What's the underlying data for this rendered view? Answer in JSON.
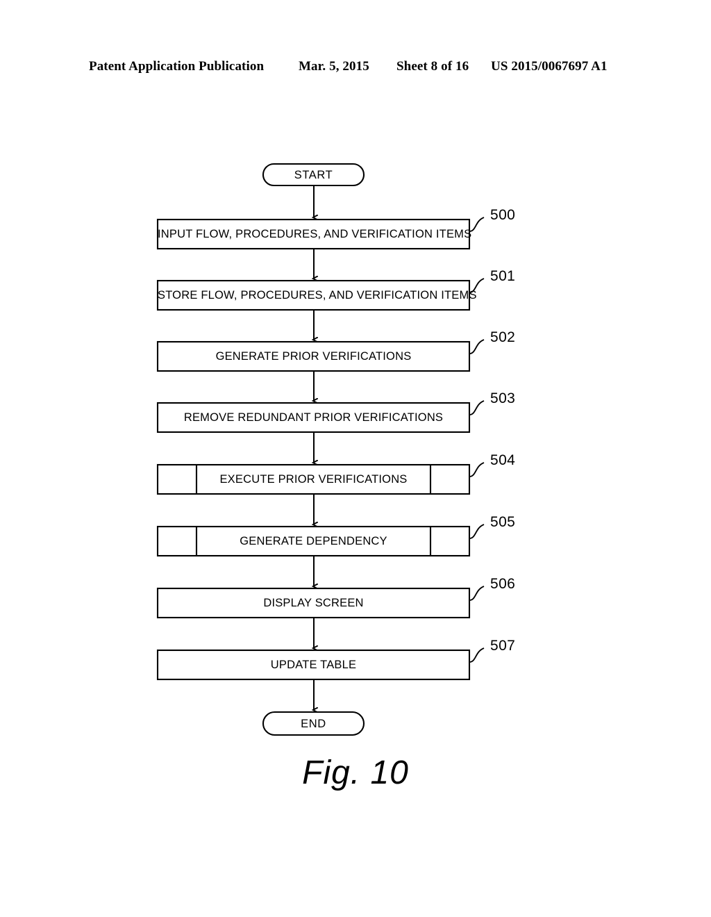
{
  "header": {
    "publication": "Patent Application Publication",
    "date": "Mar. 5, 2015",
    "sheet": "Sheet 8 of 16",
    "patent_number": "US 2015/0067697 A1"
  },
  "figure": {
    "caption": "Fig. 10",
    "stroke_color": "#000000",
    "fill_color": "#ffffff",
    "start_label": "START",
    "end_label": "END",
    "steps": [
      {
        "ref": "500",
        "label": "INPUT FLOW, PROCEDURES, AND VERIFICATION ITEMS",
        "shape": "process"
      },
      {
        "ref": "501",
        "label": "STORE FLOW, PROCEDURES, AND VERIFICATION ITEMS",
        "shape": "process"
      },
      {
        "ref": "502",
        "label": "GENERATE PRIOR VERIFICATIONS",
        "shape": "process"
      },
      {
        "ref": "503",
        "label": "REMOVE REDUNDANT PRIOR VERIFICATIONS",
        "shape": "process"
      },
      {
        "ref": "504",
        "label": "EXECUTE PRIOR VERIFICATIONS",
        "shape": "predefined-process"
      },
      {
        "ref": "505",
        "label": "GENERATE DEPENDENCY",
        "shape": "predefined-process"
      },
      {
        "ref": "506",
        "label": "DISPLAY SCREEN",
        "shape": "process"
      },
      {
        "ref": "507",
        "label": "UPDATE TABLE",
        "shape": "process"
      }
    ]
  }
}
